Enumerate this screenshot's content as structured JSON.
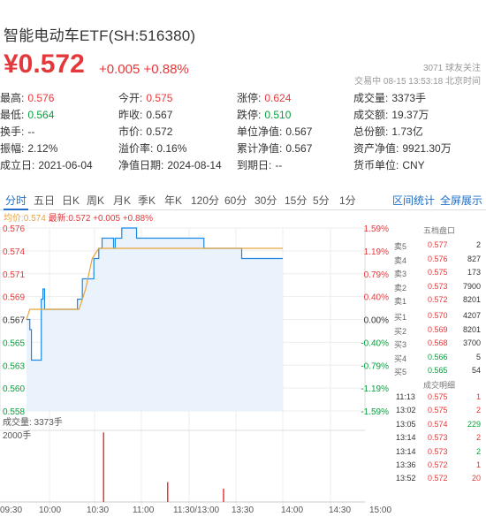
{
  "header": {
    "title": "智能电动车ETF(SH:516380)",
    "price": "¥0.572",
    "change": "+0.005 +0.88%",
    "follow": "3071 球友关注",
    "status": "交易中 08-15 13:53:18 北京时间"
  },
  "stats": [
    {
      "k": "最高:",
      "v": "0.576",
      "color": "red"
    },
    {
      "k": "今开:",
      "v": "0.575",
      "color": "red"
    },
    {
      "k": "涨停:",
      "v": "0.624",
      "color": "red"
    },
    {
      "k": "成交量:",
      "v": "3373手",
      "color": "dark"
    },
    {
      "k": "最低:",
      "v": "0.564",
      "color": "green"
    },
    {
      "k": "昨收:",
      "v": "0.567",
      "color": "dark"
    },
    {
      "k": "跌停:",
      "v": "0.510",
      "color": "green"
    },
    {
      "k": "成交额:",
      "v": "19.37万",
      "color": "dark"
    },
    {
      "k": "换手:",
      "v": "--",
      "color": "dark"
    },
    {
      "k": "市价:",
      "v": "0.572",
      "color": "dark"
    },
    {
      "k": "单位净值:",
      "v": "0.567",
      "color": "dark"
    },
    {
      "k": "总份额:",
      "v": "1.73亿",
      "color": "dark"
    },
    {
      "k": "振幅:",
      "v": "2.12%",
      "color": "dark"
    },
    {
      "k": "溢价率:",
      "v": "0.16%",
      "color": "dark"
    },
    {
      "k": "累计净值:",
      "v": "0.567",
      "color": "dark"
    },
    {
      "k": "资产净值:",
      "v": "9921.30万",
      "color": "dark"
    },
    {
      "k": "成立日:",
      "v": "2021-06-04",
      "color": "dark"
    },
    {
      "k": "净值日期:",
      "v": "2024-08-14",
      "color": "dark"
    },
    {
      "k": "到期日:",
      "v": "--",
      "color": "dark"
    },
    {
      "k": "货币单位:",
      "v": "CNY",
      "color": "dark"
    }
  ],
  "tabs": [
    "分时",
    "五日",
    "日K",
    "周K",
    "月K",
    "季K",
    "年K",
    "120分",
    "60分",
    "30分",
    "15分",
    "5分",
    "1分"
  ],
  "links": {
    "interval": "区间统计",
    "fullscreen": "全屏展示"
  },
  "chart_head": {
    "avg": "均价:0.574",
    "last": "最新:0.572 +0.005 +0.88%"
  },
  "volume_label": "成交量: 3373手",
  "volume_scale": "2000手",
  "colors": {
    "up": "#e4393c",
    "down": "#0a9e3e",
    "accent": "#1e6ec8",
    "avg_line": "#e8a33a"
  },
  "chart_data": {
    "type": "line",
    "price_ticks": [
      "0.576",
      "0.574",
      "0.571",
      "0.569",
      "0.567",
      "0.565",
      "0.563",
      "0.560",
      "0.558"
    ],
    "pct_ticks": [
      "1.59%",
      "1.19%",
      "0.79%",
      "0.40%",
      "0.00%",
      "-0.40%",
      "-0.79%",
      "-1.19%",
      "-1.59%"
    ],
    "ylim": [
      0.558,
      0.576
    ],
    "x_ticks": [
      "09:30",
      "10:00",
      "10:30",
      "11:00",
      "11:30/13:00",
      "13:30",
      "14:00",
      "14:30",
      "15:00"
    ],
    "series": [
      {
        "values": [
          [
            0,
            0.567
          ],
          [
            2,
            0.566
          ],
          [
            3,
            0.563
          ],
          [
            4,
            0.563
          ],
          [
            5,
            0.563
          ],
          [
            6,
            0.563
          ],
          [
            7,
            0.563
          ],
          [
            8,
            0.563
          ],
          [
            9,
            0.569
          ],
          [
            10,
            0.57
          ],
          [
            11,
            0.568
          ],
          [
            12,
            0.568
          ],
          [
            13,
            0.568
          ],
          [
            20,
            0.568
          ],
          [
            25,
            0.568
          ],
          [
            30,
            0.568
          ],
          [
            31,
            0.569
          ],
          [
            33,
            0.569
          ],
          [
            34,
            0.571
          ],
          [
            38,
            0.571
          ],
          [
            41,
            0.573
          ],
          [
            44,
            0.574
          ],
          [
            46,
            0.575
          ],
          [
            48,
            0.575
          ],
          [
            52,
            0.575
          ],
          [
            53,
            0.574
          ],
          [
            54,
            0.575
          ],
          [
            56,
            0.575
          ],
          [
            58,
            0.576
          ],
          [
            62,
            0.576
          ],
          [
            66,
            0.576
          ],
          [
            67,
            0.575
          ],
          [
            80,
            0.575
          ],
          [
            96,
            0.575
          ],
          [
            107,
            0.575
          ],
          [
            108,
            0.574
          ],
          [
            130,
            0.574
          ],
          [
            131,
            0.573
          ],
          [
            139,
            0.573
          ],
          [
            140,
            0.573
          ],
          [
            155,
            0.573
          ],
          [
            156,
            0.573
          ]
        ]
      },
      {
        "values": [
          [
            0,
            0.567
          ],
          [
            2,
            0.568
          ],
          [
            6,
            0.568
          ],
          [
            13,
            0.568
          ],
          [
            20,
            0.568
          ],
          [
            30,
            0.568
          ],
          [
            32,
            0.568
          ],
          [
            36,
            0.57
          ],
          [
            40,
            0.573
          ],
          [
            44,
            0.574
          ],
          [
            50,
            0.574
          ],
          [
            80,
            0.574
          ],
          [
            110,
            0.574
          ],
          [
            140,
            0.574
          ],
          [
            156,
            0.574
          ]
        ]
      }
    ],
    "volume_bars": [
      [
        46,
        2200
      ],
      [
        85,
        600
      ],
      [
        119,
        400
      ]
    ],
    "volume_max": 2000
  },
  "orderbook": {
    "title": "五档盘口",
    "rows": [
      {
        "l": "卖5",
        "p": "0.577",
        "q": "2",
        "c": "red"
      },
      {
        "l": "卖4",
        "p": "0.576",
        "q": "827",
        "c": "red"
      },
      {
        "l": "卖3",
        "p": "0.575",
        "q": "173",
        "c": "red"
      },
      {
        "l": "卖2",
        "p": "0.573",
        "q": "7900",
        "c": "red"
      },
      {
        "l": "卖1",
        "p": "0.572",
        "q": "8201",
        "c": "red"
      },
      {
        "l": "买1",
        "p": "0.570",
        "q": "4207",
        "c": "red"
      },
      {
        "l": "买2",
        "p": "0.569",
        "q": "8201",
        "c": "red"
      },
      {
        "l": "买3",
        "p": "0.568",
        "q": "3700",
        "c": "red"
      },
      {
        "l": "买4",
        "p": "0.566",
        "q": "5",
        "c": "green"
      },
      {
        "l": "买5",
        "p": "0.565",
        "q": "54",
        "c": "green"
      }
    ]
  },
  "trades": {
    "title": "成交明细",
    "rows": [
      {
        "t": "11:13",
        "p": "0.575",
        "q": "1",
        "c": "red"
      },
      {
        "t": "13:02",
        "p": "0.575",
        "q": "2",
        "c": "red"
      },
      {
        "t": "13:05",
        "p": "0.574",
        "q": "229",
        "c": "green"
      },
      {
        "t": "13:14",
        "p": "0.573",
        "q": "2",
        "c": "red"
      },
      {
        "t": "13:14",
        "p": "0.573",
        "q": "2",
        "c": "green"
      },
      {
        "t": "13:36",
        "p": "0.572",
        "q": "1",
        "c": "red"
      },
      {
        "t": "13:52",
        "p": "0.572",
        "q": "20",
        "c": "red"
      }
    ]
  }
}
